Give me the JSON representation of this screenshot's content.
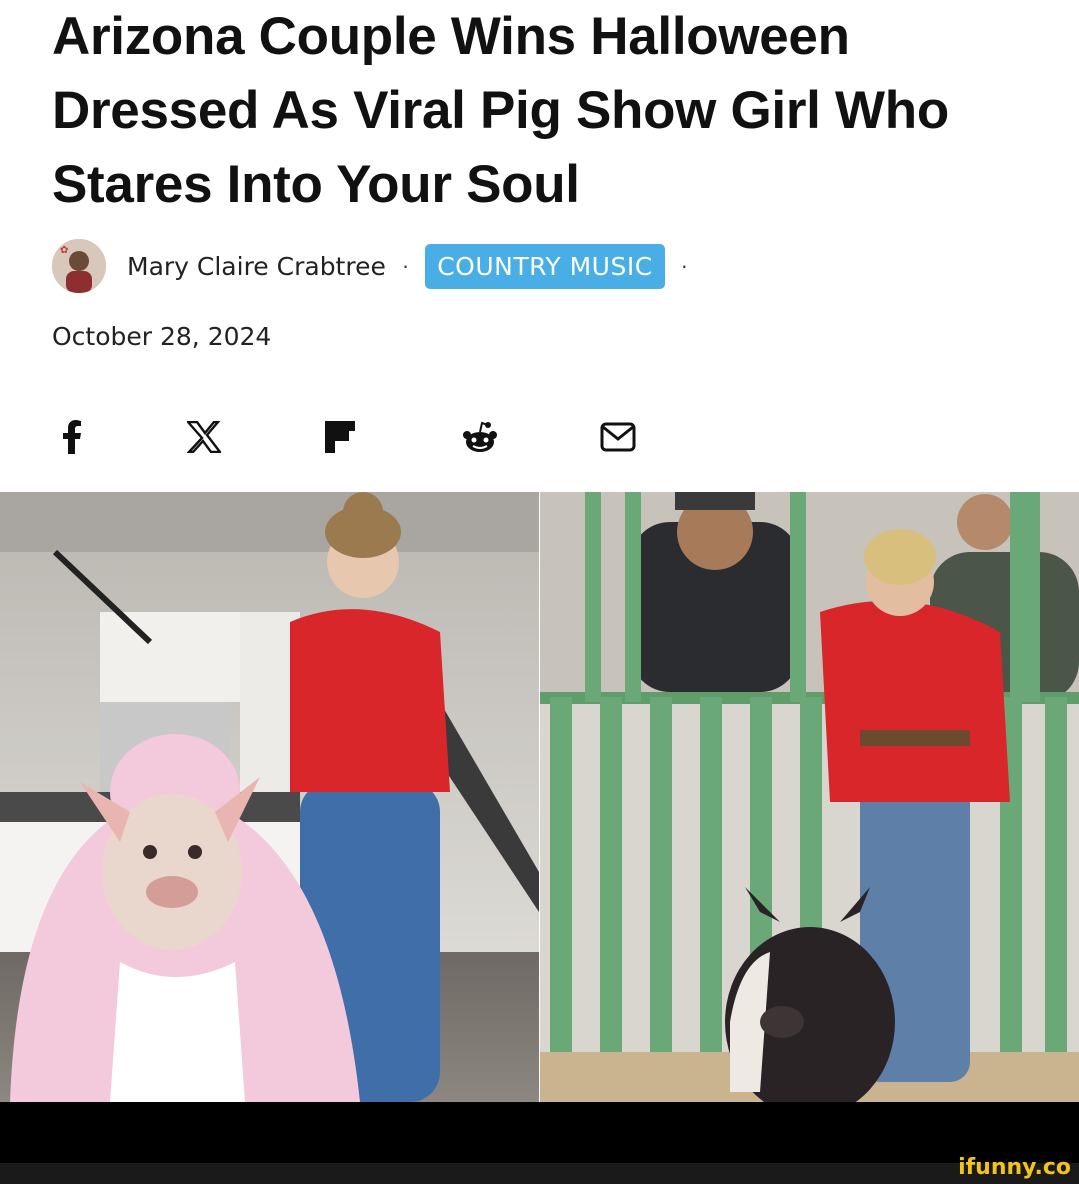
{
  "article": {
    "headline": "Arizona Couple Wins Halloween Dressed As Viral Pig Show Girl Who Stares Into Your Soul",
    "author": "Mary Claire Crabtree",
    "separator": "·",
    "category": "COUNTRY MUSIC",
    "date": "October 28, 2024"
  },
  "share": {
    "facebook_icon": "facebook-icon",
    "x_icon": "x-icon",
    "flipboard_icon": "flipboard-icon",
    "reddit_icon": "reddit-icon",
    "email_icon": "email-icon"
  },
  "images": {
    "left": "pig-costume-couple-photo",
    "right": "pig-show-girl-photo"
  },
  "colors": {
    "tag_bg": "#4aaee6",
    "watermark": "#f2c31b"
  },
  "watermark": "ifunny.co"
}
